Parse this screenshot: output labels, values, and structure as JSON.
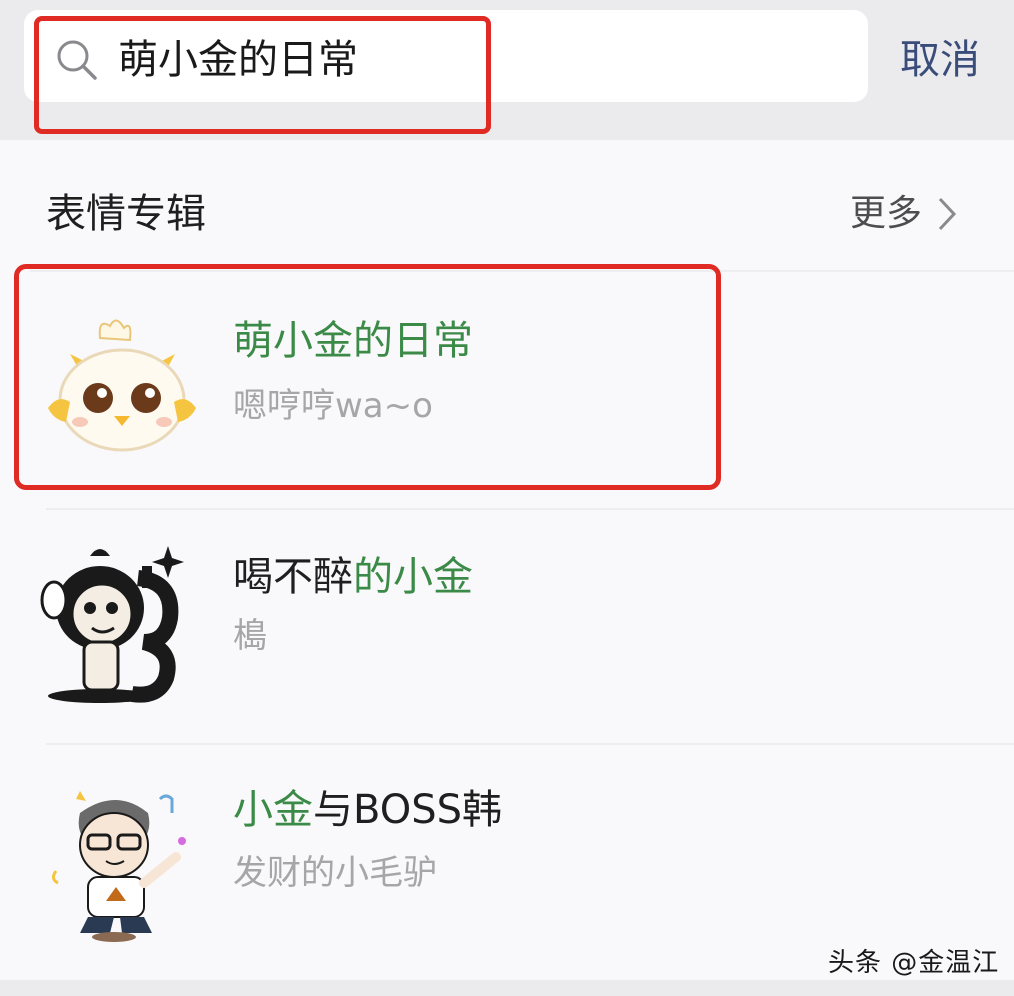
{
  "search": {
    "query": "萌小金的日常",
    "cancel_label": "取消"
  },
  "section": {
    "title": "表情专辑",
    "more_label": "更多"
  },
  "results": [
    {
      "title_plain": "",
      "title_match": "萌小金的日常",
      "title_rest": "",
      "subtitle": "嗯哼哼wa~o",
      "thumb_icon": "cartoon-chick-icon"
    },
    {
      "title_plain": "喝不醉",
      "title_match": "的小金",
      "title_rest": "",
      "subtitle": "槝",
      "thumb_icon": "cartoon-monkey-icon"
    },
    {
      "title_plain": "",
      "title_match": "小金",
      "title_rest": "与BOSS韩",
      "subtitle": "发财的小毛驴",
      "thumb_icon": "cartoon-boss-icon"
    }
  ],
  "watermark": "头条 @金温江",
  "colors": {
    "match_green": "#3c8a47",
    "highlight_red": "#e02a24",
    "cancel_blue": "#3a4d7a"
  }
}
